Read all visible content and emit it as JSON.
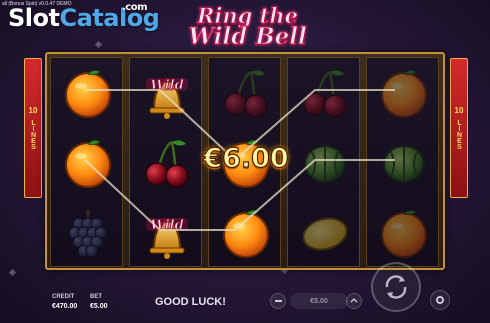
{
  "header": {
    "build_text": "all (Bonus Spin) v0.0.47 DEMO",
    "watermark_slot": "Slot",
    "watermark_catalog": "Catalog",
    "watermark_com": ".com",
    "game_title_line1": "Ring the",
    "game_title_line2": "Wild Bell"
  },
  "reels": [
    [
      "orange",
      "orange",
      "grapes"
    ],
    [
      "wild-bell",
      "cherries",
      "wild-bell"
    ],
    [
      "cherries",
      "orange",
      "orange"
    ],
    [
      "cherries",
      "watermelon",
      "lemon"
    ],
    [
      "orange",
      "watermelon",
      "orange"
    ]
  ],
  "symbol_labels": {
    "wild": "Wild"
  },
  "highlighted_cells": [
    [
      0,
      0
    ],
    [
      0,
      1
    ],
    [
      1,
      0
    ],
    [
      1,
      1
    ],
    [
      1,
      2
    ],
    [
      2,
      1
    ],
    [
      2,
      2
    ]
  ],
  "lines_banner": {
    "left_number": "10",
    "left_word": "LINES",
    "right_number": "10",
    "right_word": "LINES"
  },
  "win": {
    "amount": "€6.00"
  },
  "footer": {
    "credit_label": "CREDIT",
    "credit_value": "€470.00",
    "bet_label": "BET",
    "bet_value": "€5.00",
    "status_message": "GOOD LUCK!",
    "bet_control_value": "€5.00"
  },
  "colors": {
    "accent_gold": "#c2913a",
    "win_text": "#fff4a0",
    "banner_red": "#d42a2a",
    "watermark_blue": "#4fa8e8"
  }
}
